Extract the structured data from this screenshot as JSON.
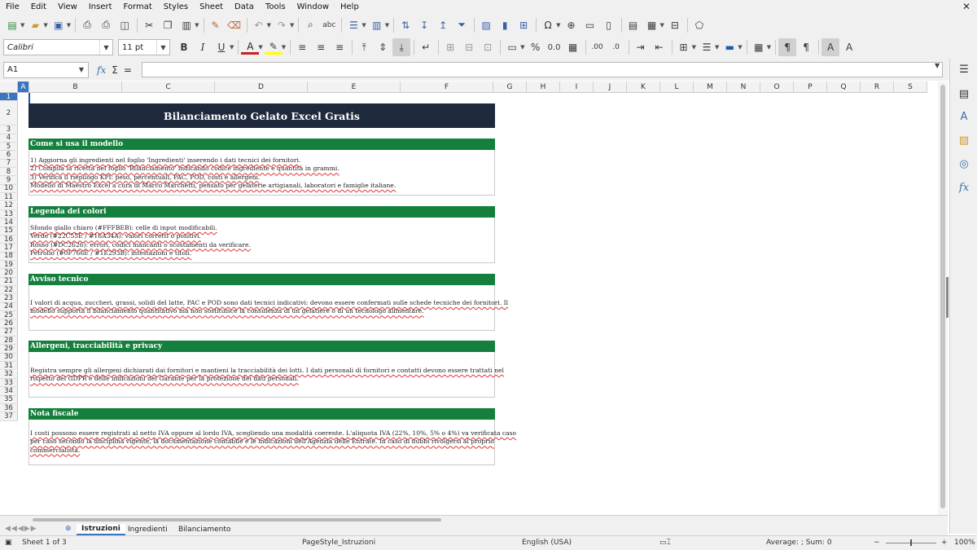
{
  "menubar": {
    "items": [
      "File",
      "Edit",
      "View",
      "Insert",
      "Format",
      "Styles",
      "Sheet",
      "Data",
      "Tools",
      "Window",
      "Help"
    ],
    "close_glyph": "✕"
  },
  "toolbar": {
    "font_name": "Calibri",
    "font_size": "11 pt"
  },
  "formula": {
    "cell_ref": "A1",
    "fx_glyph": "fx",
    "sum_glyph": "Σ",
    "equals_glyph": "="
  },
  "columns": [
    "A",
    "B",
    "C",
    "D",
    "E",
    "F",
    "G",
    "H",
    "I",
    "J",
    "K",
    "L",
    "M",
    "N",
    "O",
    "P",
    "Q",
    "R",
    "S"
  ],
  "rows": [
    "1",
    "2",
    "3",
    "4",
    "5",
    "6",
    "7",
    "8",
    "9",
    "10",
    "11",
    "12",
    "13",
    "14",
    "15",
    "16",
    "17",
    "18",
    "19",
    "20",
    "21",
    "22",
    "23",
    "24",
    "25",
    "26",
    "27",
    "28",
    "29",
    "30",
    "31",
    "32",
    "33",
    "34",
    "35",
    "36",
    "37"
  ],
  "sheet": {
    "title": "Bilanciamento Gelato Excel Gratis",
    "sections": [
      {
        "heading": "Come si usa il modello",
        "lines": [
          "1) Aggiorna gli ingredienti nel foglio 'Ingredienti' inserendo i dati tecnici dei fornitori.",
          "2) Compila la ricetta nel foglio 'Bilanciamento' indicando codice ingrediente e quantità in grammi.",
          "3) Verifica il riepilogo KPI: peso, percentuali, PAC, POD, costi e allergeni.",
          "Modello di Maestro Excel a cura di Marco Marchetti, pensato per gelaterie artigianali, laboratori e famiglie italiane."
        ]
      },
      {
        "heading": "Legenda dei colori",
        "lines": [
          "Sfondo giallo chiaro (#FFFBEB): celle di input modificabili.",
          "Verde (#22C55E / #16A34A): valori corretti o positivi.",
          "Rosso (#DC2626): errori, codici mancanti o scostamenti da verificare.",
          "Petrolio (#0F766E / #1E293B): intestazioni e titoli."
        ]
      },
      {
        "heading": "Avviso tecnico",
        "lines": [
          "I valori di acqua, zuccheri, grassi, solidi del latte, PAC e POD sono dati tecnici indicativi: devono essere confermati sulle schede tecniche dei fornitori. Il",
          "modello supporta il bilanciamento quantitativo ma non sostituisce la consulenza di un gelatiere o di un tecnologo alimentare."
        ]
      },
      {
        "heading": "Allergeni, tracciabilità e privacy",
        "lines": [
          "Registra sempre gli allergeni dichiarati dai fornitori e mantieni la tracciabilità dei lotti. I dati personali di fornitori e contatti devono essere trattati nel",
          "rispetto del GDPR e delle indicazioni del Garante per la protezione dei dati personali."
        ]
      },
      {
        "heading": "Nota fiscale",
        "lines": [
          "I costi possono essere registrati al netto IVA oppure al lordo IVA, scegliendo una modalità coerente. L'aliquota IVA (22%, 10%, 5% o 4%) va verificata caso",
          "per caso secondo la disciplina vigente, la documentazione contabile e le indicazioni dell'Agenzia delle Entrate. In caso di dubbi rivolgersi al proprio",
          "commercialista."
        ]
      }
    ]
  },
  "tabs": {
    "items": [
      "Istruzioni",
      "Ingredienti",
      "Bilanciamento"
    ],
    "active": "Istruzioni"
  },
  "status": {
    "sheet_info": "Sheet 1 of 3",
    "page_style": "PageStyle_Istruzioni",
    "language": "English (USA)",
    "summary": "Average: ; Sum: 0",
    "zoom": "100%"
  }
}
